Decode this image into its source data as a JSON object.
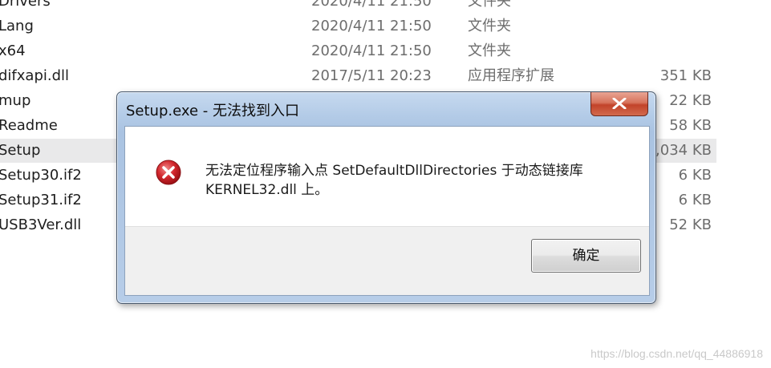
{
  "files": [
    {
      "name": "Drivers",
      "date": "2020/4/11 21:50",
      "type": "文件夹",
      "size": ""
    },
    {
      "name": "Lang",
      "date": "2020/4/11 21:50",
      "type": "文件夹",
      "size": ""
    },
    {
      "name": "x64",
      "date": "2020/4/11 21:50",
      "type": "文件夹",
      "size": ""
    },
    {
      "name": "difxapi.dll",
      "date": "2017/5/11 20:23",
      "type": "应用程序扩展",
      "size": "351 KB"
    },
    {
      "name": "mup",
      "date": "",
      "type": "",
      "size": "22 KB"
    },
    {
      "name": "Readme",
      "date": "",
      "type": "",
      "size": "58 KB"
    },
    {
      "name": "Setup",
      "date": "",
      "type": "",
      "size": ",034 KB"
    },
    {
      "name": "Setup30.if2",
      "date": "",
      "type": "",
      "size": "6 KB"
    },
    {
      "name": "Setup31.if2",
      "date": "",
      "type": "",
      "size": "6 KB"
    },
    {
      "name": "USB3Ver.dll",
      "date": "",
      "type": "",
      "size": "52 KB"
    }
  ],
  "dialog": {
    "title": "Setup.exe - 无法找到入口",
    "message_line1": "无法定位程序输入点 SetDefaultDllDirectories 于动态链接库",
    "message_line2": "KERNEL32.dll 上。",
    "ok_label": "确定",
    "icon": "error-icon"
  },
  "watermark": "https://blog.csdn.net/qq_44886918",
  "colors": {
    "close_button": "#c7462c",
    "error_icon": "#c71c22",
    "title_bar": "#b3cbe7"
  }
}
